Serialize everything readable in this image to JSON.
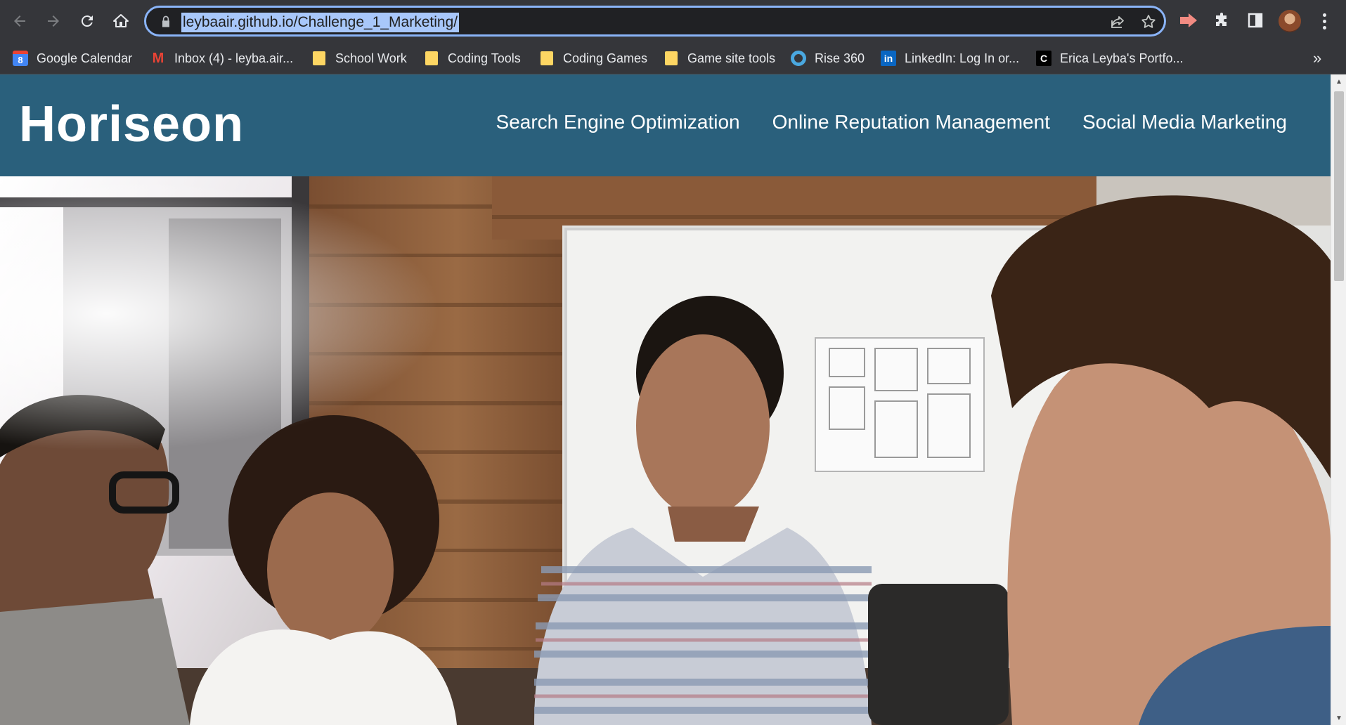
{
  "browser": {
    "url": "leybaair.github.io/Challenge_1_Marketing/",
    "bookmarks": [
      {
        "label": "Google Calendar",
        "icon": "google-calendar-icon"
      },
      {
        "label": "Inbox (4) - leyba.air...",
        "icon": "gmail-icon"
      },
      {
        "label": "School Work",
        "icon": "folder-icon"
      },
      {
        "label": "Coding Tools",
        "icon": "folder-icon"
      },
      {
        "label": "Coding Games",
        "icon": "folder-icon"
      },
      {
        "label": "Game site tools",
        "icon": "folder-icon"
      },
      {
        "label": "Rise 360",
        "icon": "rise-icon"
      },
      {
        "label": "LinkedIn: Log In or...",
        "icon": "linkedin-icon"
      },
      {
        "label": "Erica Leyba's Portfo...",
        "icon": "codepen-icon"
      }
    ],
    "bookmarks_more": "»",
    "gcal_glyph": "8",
    "gmail_glyph": "M",
    "linkedin_glyph": "in",
    "portfolio_glyph": "C"
  },
  "site": {
    "logo": "Horiseon",
    "nav": [
      "Search Engine Optimization",
      "Online Reputation Management",
      "Social Media Marketing"
    ],
    "header_color": "#2a607c"
  }
}
